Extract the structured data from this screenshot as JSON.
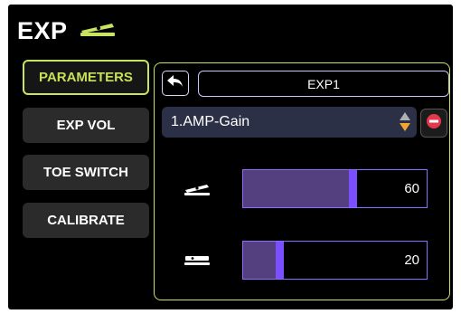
{
  "header": {
    "title": "EXP",
    "icon": "expression-pedal-icon"
  },
  "nav": {
    "items": [
      {
        "label": "PARAMETERS",
        "active": true
      },
      {
        "label": "EXP VOL",
        "active": false
      },
      {
        "label": "TOE SWITCH",
        "active": false
      },
      {
        "label": "CALIBRATE",
        "active": false
      }
    ]
  },
  "panel": {
    "back_icon": "back-arrow-icon",
    "name_value": "EXP1",
    "parameter": {
      "selected": "1.AMP-Gain",
      "arrows_icon": "up-down-arrows-icon",
      "remove_icon": "remove-icon"
    },
    "toe_slider": {
      "icon": "pedal-toe-down-icon",
      "value": "60",
      "fill_fraction": 0.6
    },
    "heel_slider": {
      "icon": "pedal-heel-down-icon",
      "value": "20",
      "fill_fraction": 0.2
    }
  },
  "colors": {
    "accent": "#c9e45f",
    "slider_border": "#8d6cff",
    "slider_fill": "#55407f",
    "thumb": "#7a4fff",
    "arrow_orange": "#f2a531",
    "remove_red": "#e6384d"
  }
}
